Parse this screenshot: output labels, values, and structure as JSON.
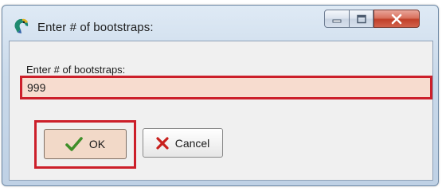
{
  "window": {
    "title": "Enter # of bootstraps:"
  },
  "form": {
    "label": "Enter # of bootstraps:",
    "input_value": "999"
  },
  "buttons": {
    "ok_label": "OK",
    "cancel_label": "Cancel"
  },
  "colors": {
    "highlight": "#cc1f2a",
    "input_background": "#f7dccf",
    "ok_check": "#3f8f2a",
    "cancel_x": "#c8201d"
  },
  "icons": {
    "app": "parrot-icon",
    "minimize": "minimize-icon",
    "maximize": "maximize-icon",
    "close": "close-icon",
    "ok": "checkmark-icon",
    "cancel": "x-mark-icon"
  }
}
